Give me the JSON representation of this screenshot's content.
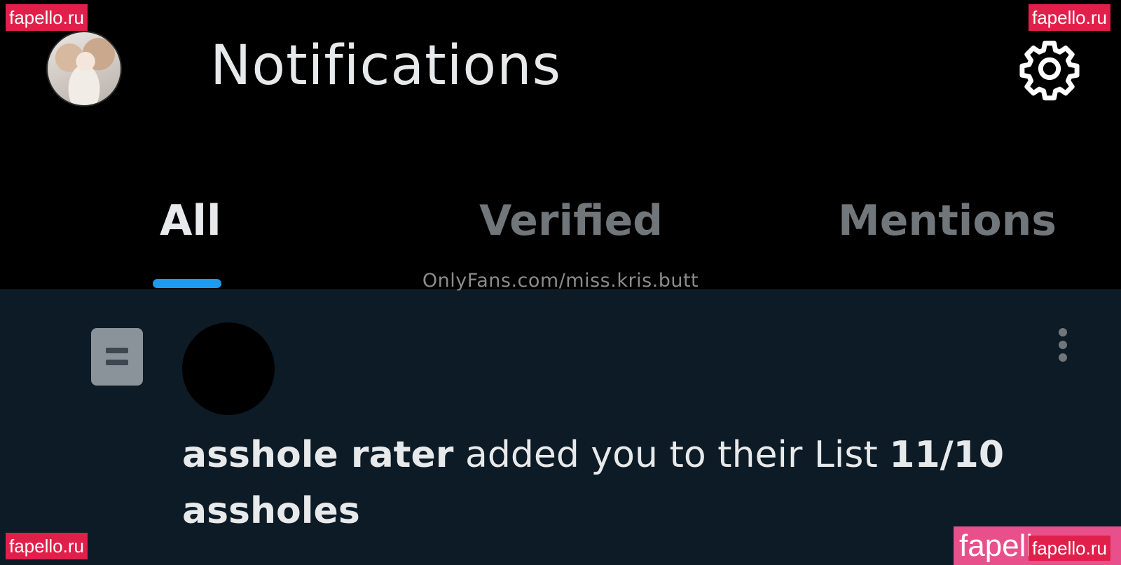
{
  "header": {
    "title": "Notifications",
    "avatar_icon": "profile-avatar",
    "settings_icon": "gear-icon"
  },
  "tabs": [
    {
      "label": "All",
      "active": true
    },
    {
      "label": "Verified",
      "active": false
    },
    {
      "label": "Mentions",
      "active": false
    }
  ],
  "source_text": "OnlyFans.com/miss.kris.butt",
  "notification": {
    "type_icon": "list-icon",
    "actor": "asshole rater",
    "action": " added you to their List ",
    "list_name": "11/10 assholes",
    "menu_icon": "more-vertical-icon"
  },
  "watermarks": {
    "top_left": "fapello.ru",
    "top_right": "fapello.ru",
    "bottom_left": "fapello.ru",
    "bottom_right_big": "fapello",
    "bottom_right_small": "fapello.ru"
  },
  "colors": {
    "background": "#000000",
    "content_background": "#0c1b26",
    "accent": "#1d9bf0",
    "text_primary": "#e7e9ea",
    "text_secondary": "#71767b",
    "watermark": "#e0204a"
  }
}
